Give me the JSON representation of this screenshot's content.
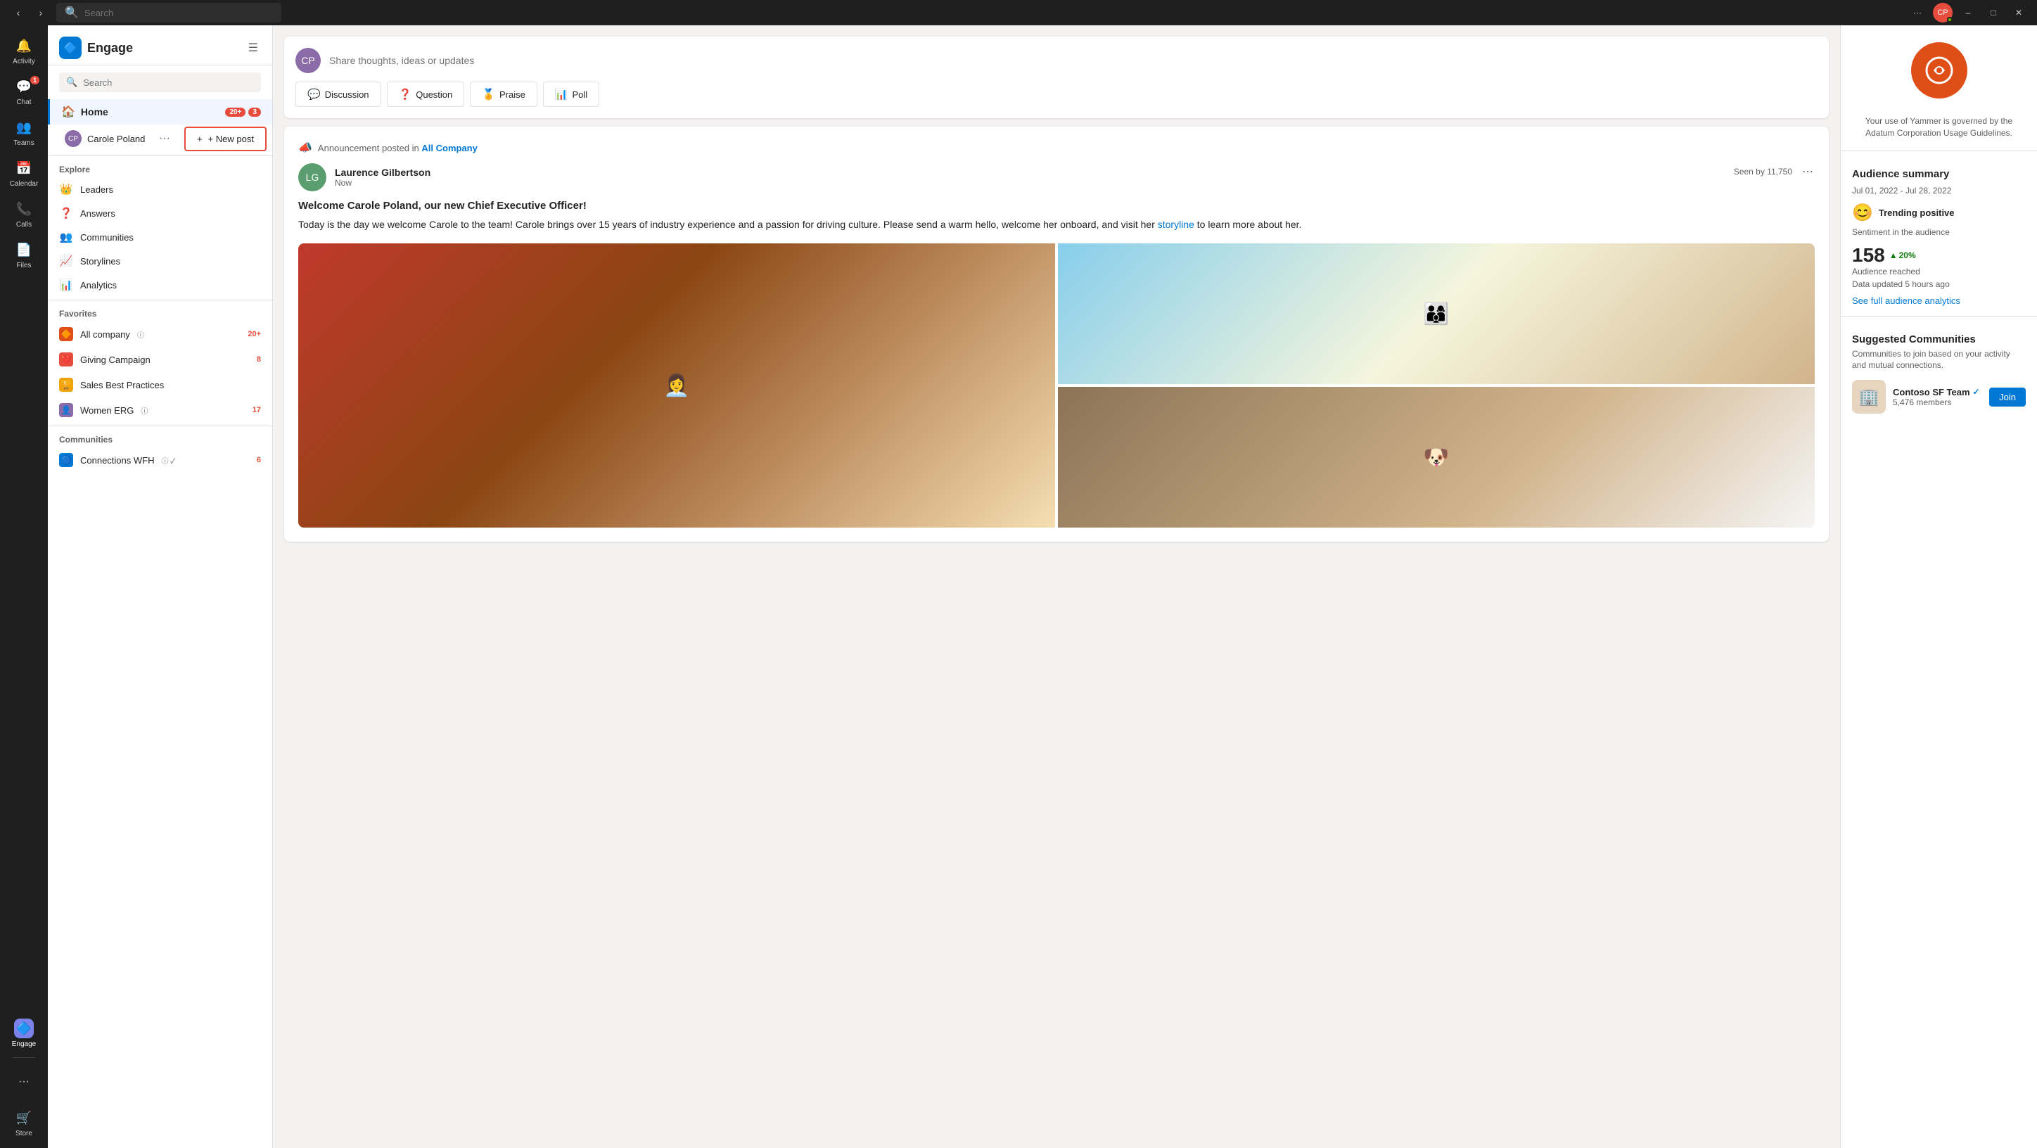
{
  "titlebar": {
    "search_placeholder": "Search",
    "back_label": "‹",
    "forward_label": "›",
    "more_label": "···",
    "minimize_label": "–",
    "maximize_label": "□",
    "close_label": "✕",
    "user_initials": "CP"
  },
  "rail": {
    "items": [
      {
        "id": "activity",
        "label": "Activity",
        "icon": "🔔",
        "badge": null
      },
      {
        "id": "chat",
        "label": "Chat",
        "icon": "💬",
        "badge": "1"
      },
      {
        "id": "teams",
        "label": "Teams",
        "icon": "👥",
        "badge": null
      },
      {
        "id": "calendar",
        "label": "Calendar",
        "icon": "📅",
        "badge": null
      },
      {
        "id": "calls",
        "label": "Calls",
        "icon": "📞",
        "badge": null
      },
      {
        "id": "files",
        "label": "Files",
        "icon": "📄",
        "badge": null
      },
      {
        "id": "engage",
        "label": "Engage",
        "icon": "🔷",
        "badge": null,
        "active": true
      }
    ],
    "more_label": "···",
    "store_label": "Store",
    "store_icon": "🛒"
  },
  "sidebar": {
    "title": "Engage",
    "logo_icon": "🔷",
    "search_placeholder": "Search",
    "home_label": "Home",
    "home_badge_count": "20+",
    "home_badge_bell": "3",
    "carole_name": "Carole Poland",
    "new_post_label": "+ New post",
    "explore_label": "Explore",
    "explore_items": [
      {
        "id": "leaders",
        "label": "Leaders",
        "icon": "👑"
      },
      {
        "id": "answers",
        "label": "Answers",
        "icon": "❓"
      },
      {
        "id": "communities",
        "label": "Communities",
        "icon": "👥"
      },
      {
        "id": "storylines",
        "label": "Storylines",
        "icon": "📈"
      },
      {
        "id": "analytics",
        "label": "Analytics",
        "icon": "📊"
      }
    ],
    "favorites_label": "Favorites",
    "favorites": [
      {
        "id": "all-company",
        "label": "All company",
        "icon": "🔶",
        "count": "20+",
        "verified": true
      },
      {
        "id": "giving-campaign",
        "label": "Giving Campaign",
        "icon": "❤️",
        "count": "8",
        "verified": false
      },
      {
        "id": "sales-best-practices",
        "label": "Sales Best Practices",
        "icon": "🏆",
        "count": null,
        "verified": false
      },
      {
        "id": "women-erg",
        "label": "Women ERG",
        "icon": "👤",
        "count": "17",
        "verified": true
      }
    ],
    "communities_label": "Communities",
    "communities": [
      {
        "id": "connections-wfh",
        "label": "Connections WFH",
        "icon": "🔵",
        "count": "6",
        "verified": true
      }
    ]
  },
  "composer": {
    "placeholder": "Share thoughts, ideas or updates",
    "actions": [
      {
        "id": "discussion",
        "label": "Discussion",
        "icon": "💬"
      },
      {
        "id": "question",
        "label": "Question",
        "icon": "❓"
      },
      {
        "id": "praise",
        "label": "Praise",
        "icon": "🏅"
      },
      {
        "id": "poll",
        "label": "Poll",
        "icon": "📊"
      }
    ]
  },
  "post": {
    "announcement_label": "Announcement",
    "posted_in_label": "posted in",
    "community": "All Company",
    "author_name": "Laurence Gilbertson",
    "author_initials": "LG",
    "time": "Now",
    "seen_by": "Seen by 11,750",
    "title": "Welcome Carole Poland, our new Chief Executive Officer!",
    "body_1": "Today is the day we welcome Carole to the team! Carole brings over 15 years of industry experience and a passion for driving culture. Please send a warm hello, welcome her onboard, and visit her ",
    "body_link": "storyline",
    "body_2": " to learn more about her."
  },
  "right_panel": {
    "logo_icon": "✦",
    "tagline": "Your use of Yammer is governed by the Adatum Corporation Usage Guidelines.",
    "audience_title": "Audience summary",
    "date_range": "Jul 01, 2022 - Jul 28, 2022",
    "sentiment_emoji": "😊",
    "sentiment_label": "Trending positive",
    "sentiment_sub": "Sentiment in the audience",
    "audience_number": "158",
    "audience_increase": "20%",
    "audience_reached_label": "Audience reached",
    "data_updated": "Data updated 5 hours ago",
    "see_analytics": "See full audience analytics",
    "suggested_title": "Suggested Communities",
    "suggested_sub": "Communities to join based on your activity and mutual connections.",
    "community_name": "Contoso SF Team",
    "community_members": "5,476 members",
    "join_label": "Join"
  }
}
